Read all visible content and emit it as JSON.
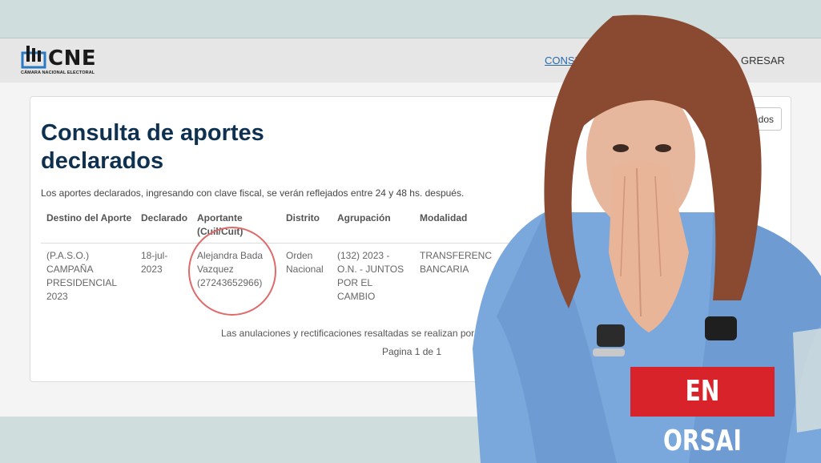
{
  "header": {
    "logo_text": "CNE",
    "logo_subtitle": "CÁMARA NACIONAL ELECTORAL",
    "nav_consulta": "CONSULTA D",
    "nav_ingresar": "GRESAR"
  },
  "card": {
    "title": "Consulta de aportes declarados",
    "button_label": "ados",
    "intro": "Los aportes declarados, ingresando con clave fiscal, se verán reflejados entre 24 y 48 hs. después.",
    "columns": [
      "Destino del Aporte",
      "Declarado",
      "Aportante (Cuil/Cuit)",
      "Distrito",
      "Agrupación",
      "Modalidad"
    ],
    "row": {
      "destino": "(P.A.S.O.) CAMPAÑA PRESIDENCIAL 2023",
      "declarado": "18-jul-2023",
      "aportante": "Alejandra Bada Vazquez (27243652966)",
      "distrito": "Orden Nacional",
      "agrupacion": "(132) 2023 - O.N. - JUNTOS POR EL CAMBIO",
      "modalidad": "TRANSFERENC BANCARIA"
    },
    "footnote": "Las anulaciones y rectificaciones resaltadas se realizan por el",
    "pager": "Pagina 1 de 1"
  },
  "overlay": {
    "badge": "EN ORSAI"
  },
  "colors": {
    "title": "#0f3150",
    "link": "#2a6aa8",
    "badge": "#d9232b",
    "circle": "#e06a6a",
    "jacket": "#7aa8dc"
  }
}
